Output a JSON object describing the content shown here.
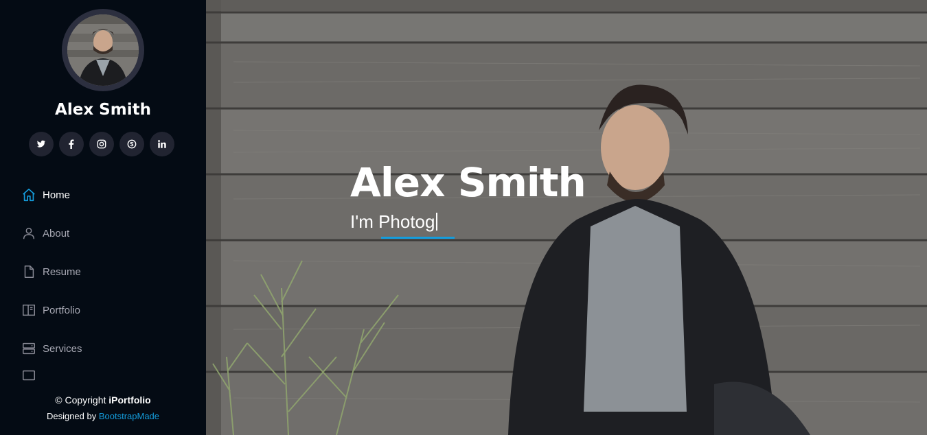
{
  "profile": {
    "name": "Alex Smith"
  },
  "social": [
    {
      "icon": "twitter-icon",
      "label": "Twitter"
    },
    {
      "icon": "facebook-icon",
      "label": "Facebook"
    },
    {
      "icon": "instagram-icon",
      "label": "Instagram"
    },
    {
      "icon": "skype-icon",
      "label": "Skype"
    },
    {
      "icon": "linkedin-icon",
      "label": "LinkedIn"
    }
  ],
  "nav": {
    "items": [
      {
        "label": "Home",
        "icon": "home-icon",
        "active": true
      },
      {
        "label": "About",
        "icon": "person-icon",
        "active": false
      },
      {
        "label": "Resume",
        "icon": "file-icon",
        "active": false
      },
      {
        "label": "Portfolio",
        "icon": "book-icon",
        "active": false
      },
      {
        "label": "Services",
        "icon": "server-icon",
        "active": false
      }
    ]
  },
  "footer": {
    "copyright_prefix": "© Copyright ",
    "brand": "iPortfolio",
    "designed_prefix": "Designed by ",
    "designer": "BootstrapMade"
  },
  "hero": {
    "title": "Alex Smith",
    "subtitle": "I'm Photog"
  },
  "colors": {
    "accent": "#149ddd",
    "sidebar_bg": "#040b14",
    "social_bg": "#212431",
    "nav_text": "#a8a9b4"
  }
}
